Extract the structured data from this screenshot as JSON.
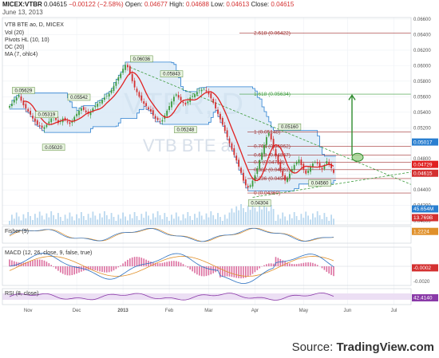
{
  "header": {
    "symbol": "MICEX:VTBR",
    "last": "0.04615",
    "change": "−0.00122 (−2.58%)",
    "open_label": "Open:",
    "open": "0.04677",
    "high_label": "High:",
    "high": "0.04688",
    "low_label": "Low:",
    "low": "0.04613",
    "close_label": "Close:",
    "close": "0.04615",
    "date": "June 13, 2013"
  },
  "legend": {
    "title": "VTB BTE ao, D, MICEX",
    "vol": "Vol (20)",
    "pivots": "Pivots HL (10, 10)",
    "dc": "DC (20)",
    "ma": "MA (7, ohlc4)"
  },
  "watermark": {
    "big": "VTBR, D",
    "small": "VTB BTE ao"
  },
  "source": {
    "prefix": "Source:",
    "brand": "TradingView.com"
  },
  "colors": {
    "up": "#3d9b3d",
    "down": "#d43030",
    "ma": "#e02020",
    "dc": "#2a7fd0",
    "dc_fill": "#d6e7f5",
    "fib": "#a03030",
    "fib_green": "#3d9b3d",
    "trend": "#3d9b3d",
    "arrow": "#2e8b2e",
    "vol": "#9cc8e8"
  },
  "chart_data": [
    {
      "type": "candlestick",
      "title": "VTB BTE ao, D, MICEX",
      "x_tick_labels": [
        "Nov",
        "Dec",
        "2013",
        "Feb",
        "Mar",
        "Apr",
        "May",
        "Jun",
        "Jul"
      ],
      "ylim": [
        0.0395,
        0.0662
      ],
      "y_tick_labels": [
        "0.06600",
        "0.06400",
        "0.06200",
        "0.06000",
        "0.05800",
        "0.05600",
        "0.05400",
        "0.05200",
        "0.05000",
        "0.04800",
        "0.04600",
        "0.04400",
        "0.04200",
        "0.04000"
      ],
      "current_price_labels": [
        {
          "value": "0.05017",
          "color": "#2a7fd0"
        },
        {
          "value": "0.04729",
          "color": "#e02020"
        },
        {
          "value": "0.04615",
          "color": "#d43030"
        },
        {
          "value": "45.654M",
          "color": "#2a7fd0"
        },
        {
          "value": "13.769B",
          "color": "#d43030"
        }
      ],
      "closes": [
        0.0548,
        0.0551,
        0.0556,
        0.0559,
        0.0562,
        0.0555,
        0.0549,
        0.0545,
        0.0541,
        0.0537,
        0.0532,
        0.0528,
        0.0524,
        0.0522,
        0.052,
        0.0521,
        0.0524,
        0.0528,
        0.0532,
        0.0536,
        0.053,
        0.0526,
        0.0528,
        0.0532,
        0.053,
        0.0527,
        0.0525,
        0.0529,
        0.0534,
        0.0538,
        0.0542,
        0.0545,
        0.0543,
        0.054,
        0.0538,
        0.0541,
        0.0545,
        0.0548,
        0.0551,
        0.0553,
        0.0556,
        0.0559,
        0.0561,
        0.0564,
        0.0569,
        0.0574,
        0.0579,
        0.0585,
        0.059,
        0.0596,
        0.0601,
        0.0598,
        0.059,
        0.058,
        0.0572,
        0.0566,
        0.056,
        0.0555,
        0.0551,
        0.0548,
        0.0544,
        0.0541,
        0.0536,
        0.0532,
        0.053,
        0.0528,
        0.053,
        0.0536,
        0.0542,
        0.0548,
        0.0554,
        0.056,
        0.0563,
        0.0559,
        0.0555,
        0.0552,
        0.055,
        0.0554,
        0.0559,
        0.0561,
        0.0563,
        0.0566,
        0.0568,
        0.0569,
        0.057,
        0.0567,
        0.0563,
        0.0558,
        0.0552,
        0.0545,
        0.0538,
        0.0531,
        0.0524,
        0.0516,
        0.0508,
        0.05,
        0.0492,
        0.0485,
        0.0478,
        0.047,
        0.0462,
        0.0452,
        0.0446,
        0.0443,
        0.0446,
        0.0452,
        0.0459,
        0.0468,
        0.0478,
        0.0488,
        0.0498,
        0.0508,
        0.0513,
        0.0505,
        0.0494,
        0.0484,
        0.0474,
        0.0465,
        0.0458,
        0.0452,
        0.0455,
        0.0461,
        0.0467,
        0.0472,
        0.0476,
        0.0479,
        0.0472,
        0.0466,
        0.0461,
        0.0465,
        0.047,
        0.0474,
        0.0476,
        0.0474,
        0.047,
        0.0467,
        0.0472,
        0.0477,
        0.0473,
        0.0468,
        0.0462
      ],
      "pivot_labels": [
        {
          "text": "0.05629",
          "value": 0.05629
        },
        {
          "text": "0.05319",
          "value": 0.05319
        },
        {
          "text": "0.05020",
          "value": 0.0502
        },
        {
          "text": "0.05542",
          "value": 0.05542
        },
        {
          "text": "0.06036",
          "value": 0.06036
        },
        {
          "text": "0.05843",
          "value": 0.05843
        },
        {
          "text": "0.05248",
          "value": 0.05248
        },
        {
          "text": "0.05160",
          "value": 0.0516
        },
        {
          "text": "0.04304",
          "value": 0.04304
        },
        {
          "text": "0.04560",
          "value": 0.0456
        }
      ],
      "fib_levels": [
        {
          "ratio": "2.618",
          "value": 0.06422
        },
        {
          "ratio": "1.618",
          "value": 0.05634
        },
        {
          "ratio": "1",
          "value": 0.05148
        },
        {
          "ratio": "0.764",
          "value": 0.04962
        },
        {
          "ratio": "0.618",
          "value": 0.04847
        },
        {
          "ratio": "0.5",
          "value": 0.04754
        },
        {
          "ratio": "0.382",
          "value": 0.04661
        },
        {
          "ratio": "0.236",
          "value": 0.04546
        },
        {
          "ratio": "0",
          "value": 0.0436
        }
      ]
    },
    {
      "type": "line",
      "title": "Fisher (9)",
      "ylim": [
        -3,
        3
      ],
      "value_label": "1.2224"
    },
    {
      "type": "line",
      "title": "MACD (12, 26, close, 9, false, true)",
      "ylim": [
        -0.0025,
        0.0025
      ],
      "y_tick_labels": [
        "0.0000",
        "-0.0020"
      ],
      "value_label": "-0.0002"
    },
    {
      "type": "line",
      "title": "RSI (8, close)",
      "ylim": [
        0,
        100
      ],
      "value_label": "42.4140"
    }
  ]
}
